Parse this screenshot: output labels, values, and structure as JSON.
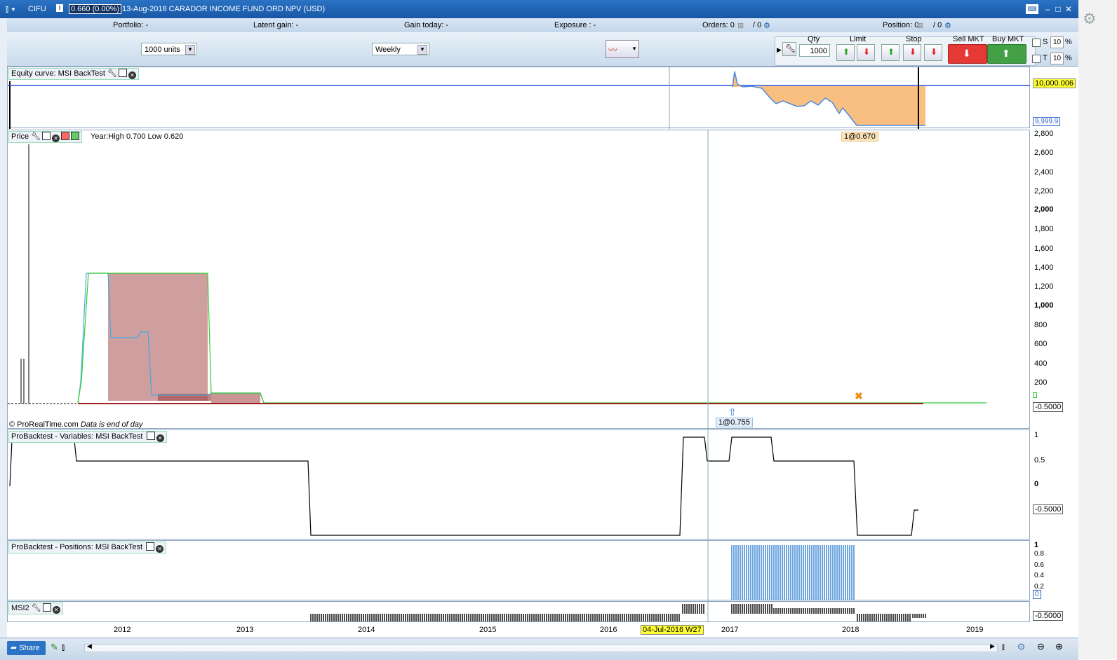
{
  "title": {
    "ticker": "CIFU",
    "price": "0.660 (0.00%)",
    "description": "13-Aug-2018 CARADOR INCOME FUND ORD NPV (USD)"
  },
  "infobar": {
    "portfolio": "Portfolio: -",
    "latent_gain": "Latent gain: -",
    "gain_today": "Gain today: -",
    "exposure": "Exposure : -",
    "orders_label": "Orders: 0",
    "orders_sep": "/ 0",
    "position_label": "Position: 0",
    "position_sep": "/ 0"
  },
  "toolbar": {
    "units_value": "1000 units",
    "period_value": "Weekly",
    "qty_label": "Qty",
    "qty_value": "1000",
    "limit_label": "Limit",
    "stop_label": "Stop",
    "sell_label": "Sell MKT",
    "buy_label": "Buy MKT",
    "s_label": "S",
    "t_label": "T",
    "s_value": "10",
    "t_value": "10",
    "pct": "%"
  },
  "equity": {
    "title": "Equity curve: MSI BackTest",
    "value_top": "10,000.006",
    "value_bottom": "9,999.9"
  },
  "price_panel": {
    "title": "Price",
    "year_info": "Year:High 0.700 Low 0.620",
    "copyright": "© ProRealTime.com",
    "eod_note": "Data is end of day",
    "trade_label_top": "1@0.670",
    "trade_label_bottom": "1@0.755",
    "axis_value": "-0.5000",
    "ticks": [
      "2,800",
      "2,600",
      "2,400",
      "2,200",
      "2,000",
      "1,800",
      "1,600",
      "1,400",
      "1,200",
      "1,000",
      "800",
      "600",
      "400",
      "200"
    ]
  },
  "variables": {
    "title": "ProBacktest - Variables: MSI BackTest",
    "ticks": [
      "1",
      "0.5",
      "0"
    ],
    "value_box": "-0.5000"
  },
  "positions": {
    "title": "ProBacktest - Positions: MSI BackTest",
    "ticks": [
      "1",
      "0.8",
      "0.6",
      "0.4",
      "0.2"
    ],
    "value_box": "0"
  },
  "msi2": {
    "title": "MSI2",
    "value_box": "-0.5000"
  },
  "xaxis": {
    "labels": [
      "2012",
      "2013",
      "2014",
      "2015",
      "2016",
      "2017",
      "2018",
      "2019"
    ],
    "cursor_date": "04-Jul-2016 W27"
  },
  "bottom": {
    "share_label": "Share"
  },
  "colors": {
    "title_bar": "#1f63b4",
    "equity_fill": "#f8b46a",
    "price_fill": "#a84f4f",
    "positions_bar": "#4a90d9",
    "sell": "#e53935",
    "buy": "#43a047",
    "accent_yellow": "#ffff33"
  }
}
